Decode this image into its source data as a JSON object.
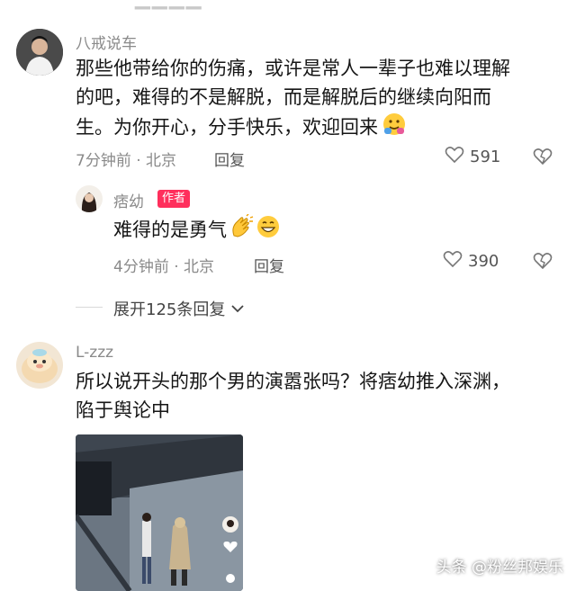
{
  "comments": [
    {
      "username": "八戒说车",
      "text_line1": "那些他带给你的伤痛，或许是常人一辈子也难以理解",
      "text_line2": "的吧，难得的不是解脱，而是解脱后的继续向阳而",
      "text_line3": "生。为你开心，分手快乐，欢迎回来",
      "time_location": "7分钟前 · 北京",
      "reply_label": "回复",
      "likes": "591"
    },
    {
      "username": "痞幼",
      "badge": "作者",
      "text": "难得的是勇气",
      "time_location": "4分钟前 · 北京",
      "reply_label": "回复",
      "likes": "390"
    },
    {
      "username": "L-zzz",
      "text_line1": "所以说开头的那个男的演嚣张吗？将痞幼推入深渊，",
      "text_line2": "陷于舆论中"
    }
  ],
  "expand_replies": "展开125条回复",
  "watermark": "头条 @粉丝邦娱乐",
  "icons": [
    "heart-icon",
    "dislike-heart-icon",
    "chevron-down-icon",
    "hug-emoji",
    "clap-emoji",
    "grin-emoji"
  ],
  "colors": {
    "badge": "#ff2f5c",
    "meta": "#8a8a8a"
  }
}
